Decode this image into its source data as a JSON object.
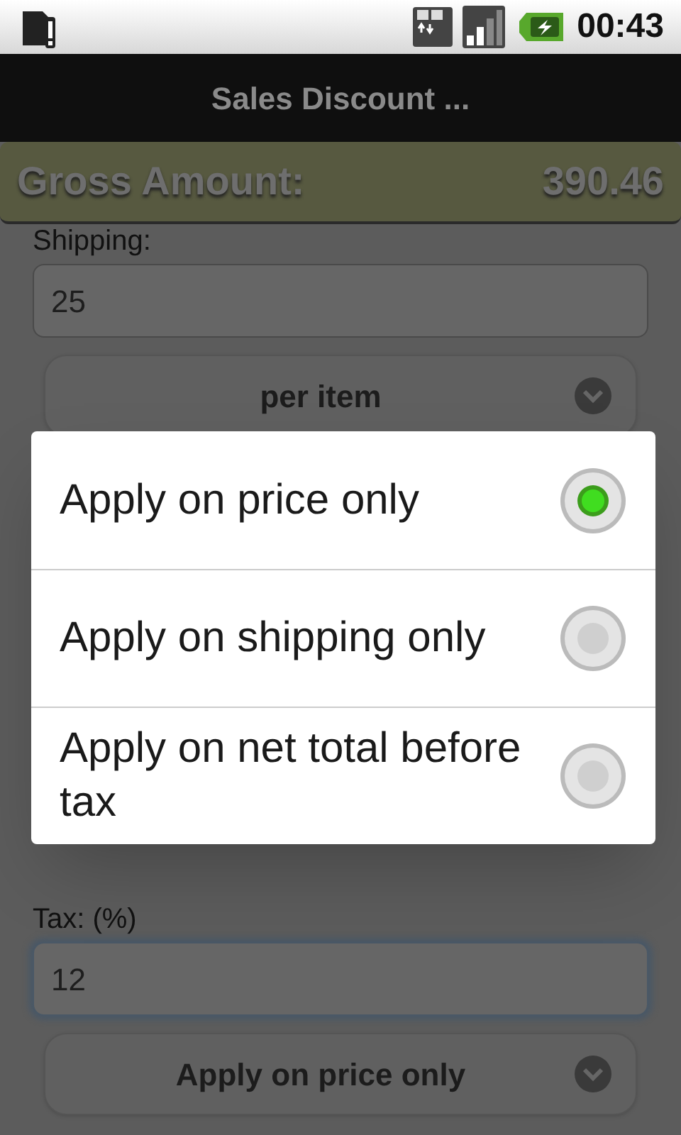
{
  "status_bar": {
    "time": "00:43"
  },
  "title": "Sales Discount ...",
  "gross_amount": {
    "label": "Gross Amount:",
    "value": "390.46"
  },
  "upper_form": [
    {
      "kind": "label",
      "text": "Shipping:"
    },
    {
      "kind": "field",
      "value": "25",
      "focused": false
    },
    {
      "kind": "spinner",
      "value": "per item"
    }
  ],
  "lower_form": [
    {
      "kind": "label",
      "text": "Tax: (%)"
    },
    {
      "kind": "field",
      "value": "12",
      "focused": true
    },
    {
      "kind": "spinner",
      "value": "Apply on price only"
    }
  ],
  "dialog": {
    "options": [
      {
        "label": "Apply on price only",
        "selected": true
      },
      {
        "label": "Apply on shipping only",
        "selected": false
      },
      {
        "label": "Apply on net total before tax",
        "selected": false
      }
    ]
  }
}
